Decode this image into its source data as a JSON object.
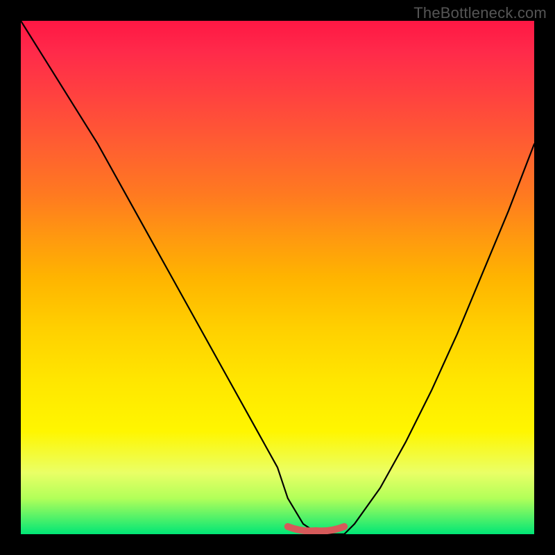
{
  "watermark": "TheBottleneck.com",
  "chart_data": {
    "type": "line",
    "title": "",
    "xlabel": "",
    "ylabel": "",
    "xlim": [
      0,
      100
    ],
    "ylim": [
      0,
      100
    ],
    "grid": false,
    "legend": false,
    "annotations": [],
    "series": [
      {
        "name": "curve",
        "x": [
          0,
          5,
          10,
          15,
          20,
          25,
          30,
          35,
          40,
          45,
          50,
          52,
          55,
          58,
          60,
          63,
          65,
          70,
          75,
          80,
          85,
          90,
          95,
          100
        ],
        "values": [
          100,
          92,
          84,
          76,
          67,
          58,
          49,
          40,
          31,
          22,
          13,
          7,
          2,
          0,
          0,
          0,
          2,
          9,
          18,
          28,
          39,
          51,
          63,
          76
        ]
      }
    ],
    "markers": [
      {
        "name": "optimum",
        "x_start": 52,
        "x_end": 63,
        "y": 0
      }
    ],
    "gradient_stops": [
      {
        "pos": 0,
        "color": "#ff1744"
      },
      {
        "pos": 50,
        "color": "#ffb400"
      },
      {
        "pos": 80,
        "color": "#fff600"
      },
      {
        "pos": 100,
        "color": "#00e676"
      }
    ]
  }
}
